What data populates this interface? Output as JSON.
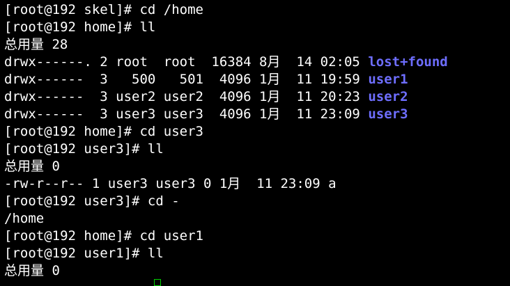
{
  "terminal": {
    "lines": [
      "[root@192 skel]# cd /home",
      "[root@192 home]# ll",
      "总用量 28",
      "drwx------. 2 root  root  16384 8月  14 02:05 ",
      "drwx------  3   500   501  4096 1月  11 19:59 ",
      "drwx------  3 user2 user2  4096 1月  11 20:23 ",
      "drwx------  3 user3 user3  4096 1月  11 23:09 ",
      "[root@192 home]# cd user3",
      "[root@192 user3]# ll",
      "总用量 0",
      "-rw-r--r-- 1 user3 user3 0 1月  11 23:09 a",
      "[root@192 user3]# cd -",
      "/home",
      "[root@192 home]# cd user1",
      "[root@192 user1]# ll",
      "总用量 0"
    ],
    "dir_names": [
      "lost+found",
      "user1",
      "user2",
      "user3"
    ],
    "colors": {
      "background": "#000000",
      "text": "#ffffff",
      "directory": "#6e6eff",
      "cursor": "#00d000"
    }
  }
}
